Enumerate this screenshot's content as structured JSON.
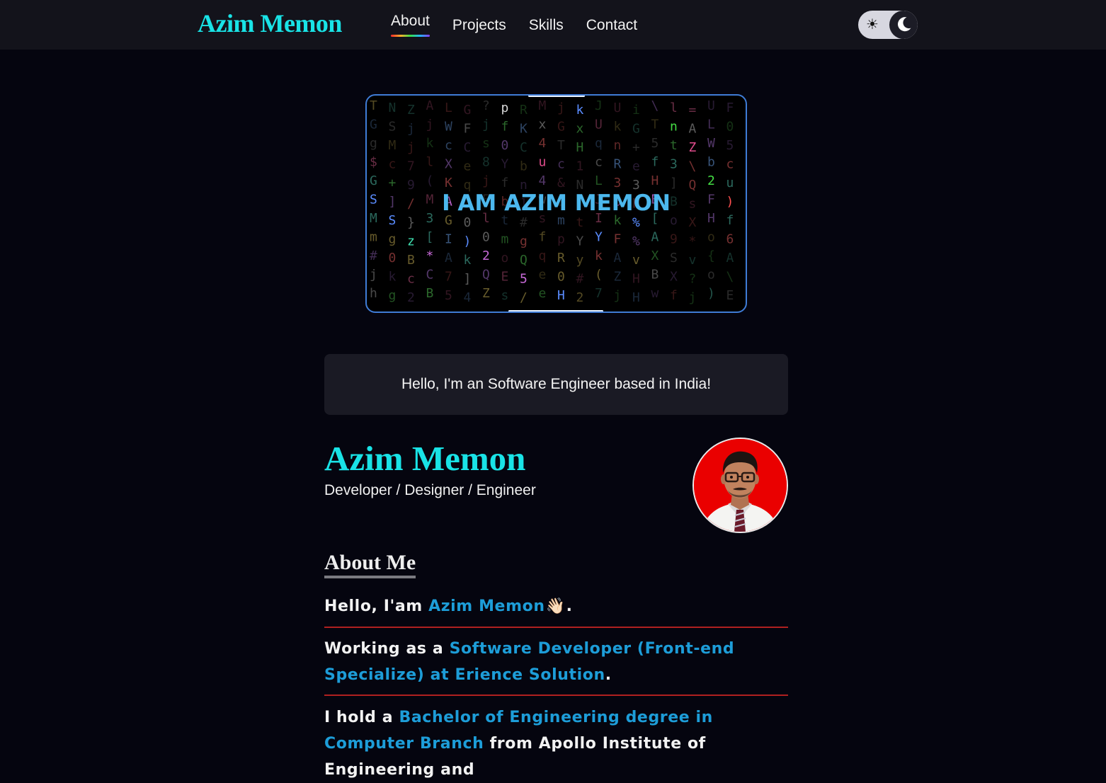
{
  "header": {
    "logo": "Azim Memon",
    "nav": [
      {
        "label": "About",
        "active": true
      },
      {
        "label": "Projects",
        "active": false
      },
      {
        "label": "Skills",
        "active": false
      },
      {
        "label": "Contact",
        "active": false
      }
    ],
    "theme_toggle": {
      "left_icon": "sun-icon",
      "right_icon": "moon-icon",
      "mode": "dark"
    }
  },
  "hero": {
    "title": "I AM AZIM MEMON",
    "background_icon": "matrix-rain"
  },
  "greeting": "Hello, I'm an Software Engineer based in India!",
  "profile": {
    "name": "Azim Memon",
    "role": "Developer / Designer / Engineer",
    "avatar_icon": "profile-photo"
  },
  "about": {
    "heading": "About Me",
    "intro": {
      "prefix": "Hello, I'am ",
      "name": "Azim Memon",
      "suffix": "."
    },
    "work": {
      "prefix": "Working as a ",
      "highlight": "Software Developer (Front-end Specialize) at Erience Solution",
      "suffix": "."
    },
    "education": {
      "prefix": "I hold a ",
      "highlight": "Bachelor of Engineering degree in Computer Branch",
      "suffix": " from Apollo Institute of Engineering and"
    }
  },
  "colors": {
    "accent": "#19e3e6",
    "highlight": "#1d9dd8",
    "divider": "#b02020",
    "hero_border": "#3f7cd6"
  }
}
